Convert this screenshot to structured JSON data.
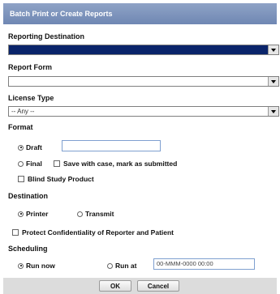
{
  "dialog": {
    "title": "Batch Print or Create Reports"
  },
  "reporting_destination": {
    "label": "Reporting Destination",
    "value": ""
  },
  "report_form": {
    "label": "Report Form",
    "value": ""
  },
  "license_type": {
    "label": "License Type",
    "value": "-- Any --"
  },
  "format": {
    "label": "Format",
    "draft_label": "Draft",
    "draft_text": "",
    "final_label": "Final",
    "save_with_case_label": "Save with case, mark as submitted",
    "blind_study_label": "Blind Study Product",
    "selected": "Draft"
  },
  "destination": {
    "label": "Destination",
    "printer_label": "Printer",
    "transmit_label": "Transmit",
    "selected": "Printer"
  },
  "protect_label": "Protect Confidentiality of Reporter and Patient",
  "scheduling": {
    "label": "Scheduling",
    "run_now_label": "Run now",
    "run_at_label": "Run at",
    "run_at_value": "00-MMM-0000 00:00",
    "selected": "Run now"
  },
  "buttons": {
    "ok": "OK",
    "cancel": "Cancel"
  },
  "colors": {
    "title_bar": "#7a90bb",
    "selected_field": "#0a246a",
    "footer": "#dcdcdc"
  }
}
